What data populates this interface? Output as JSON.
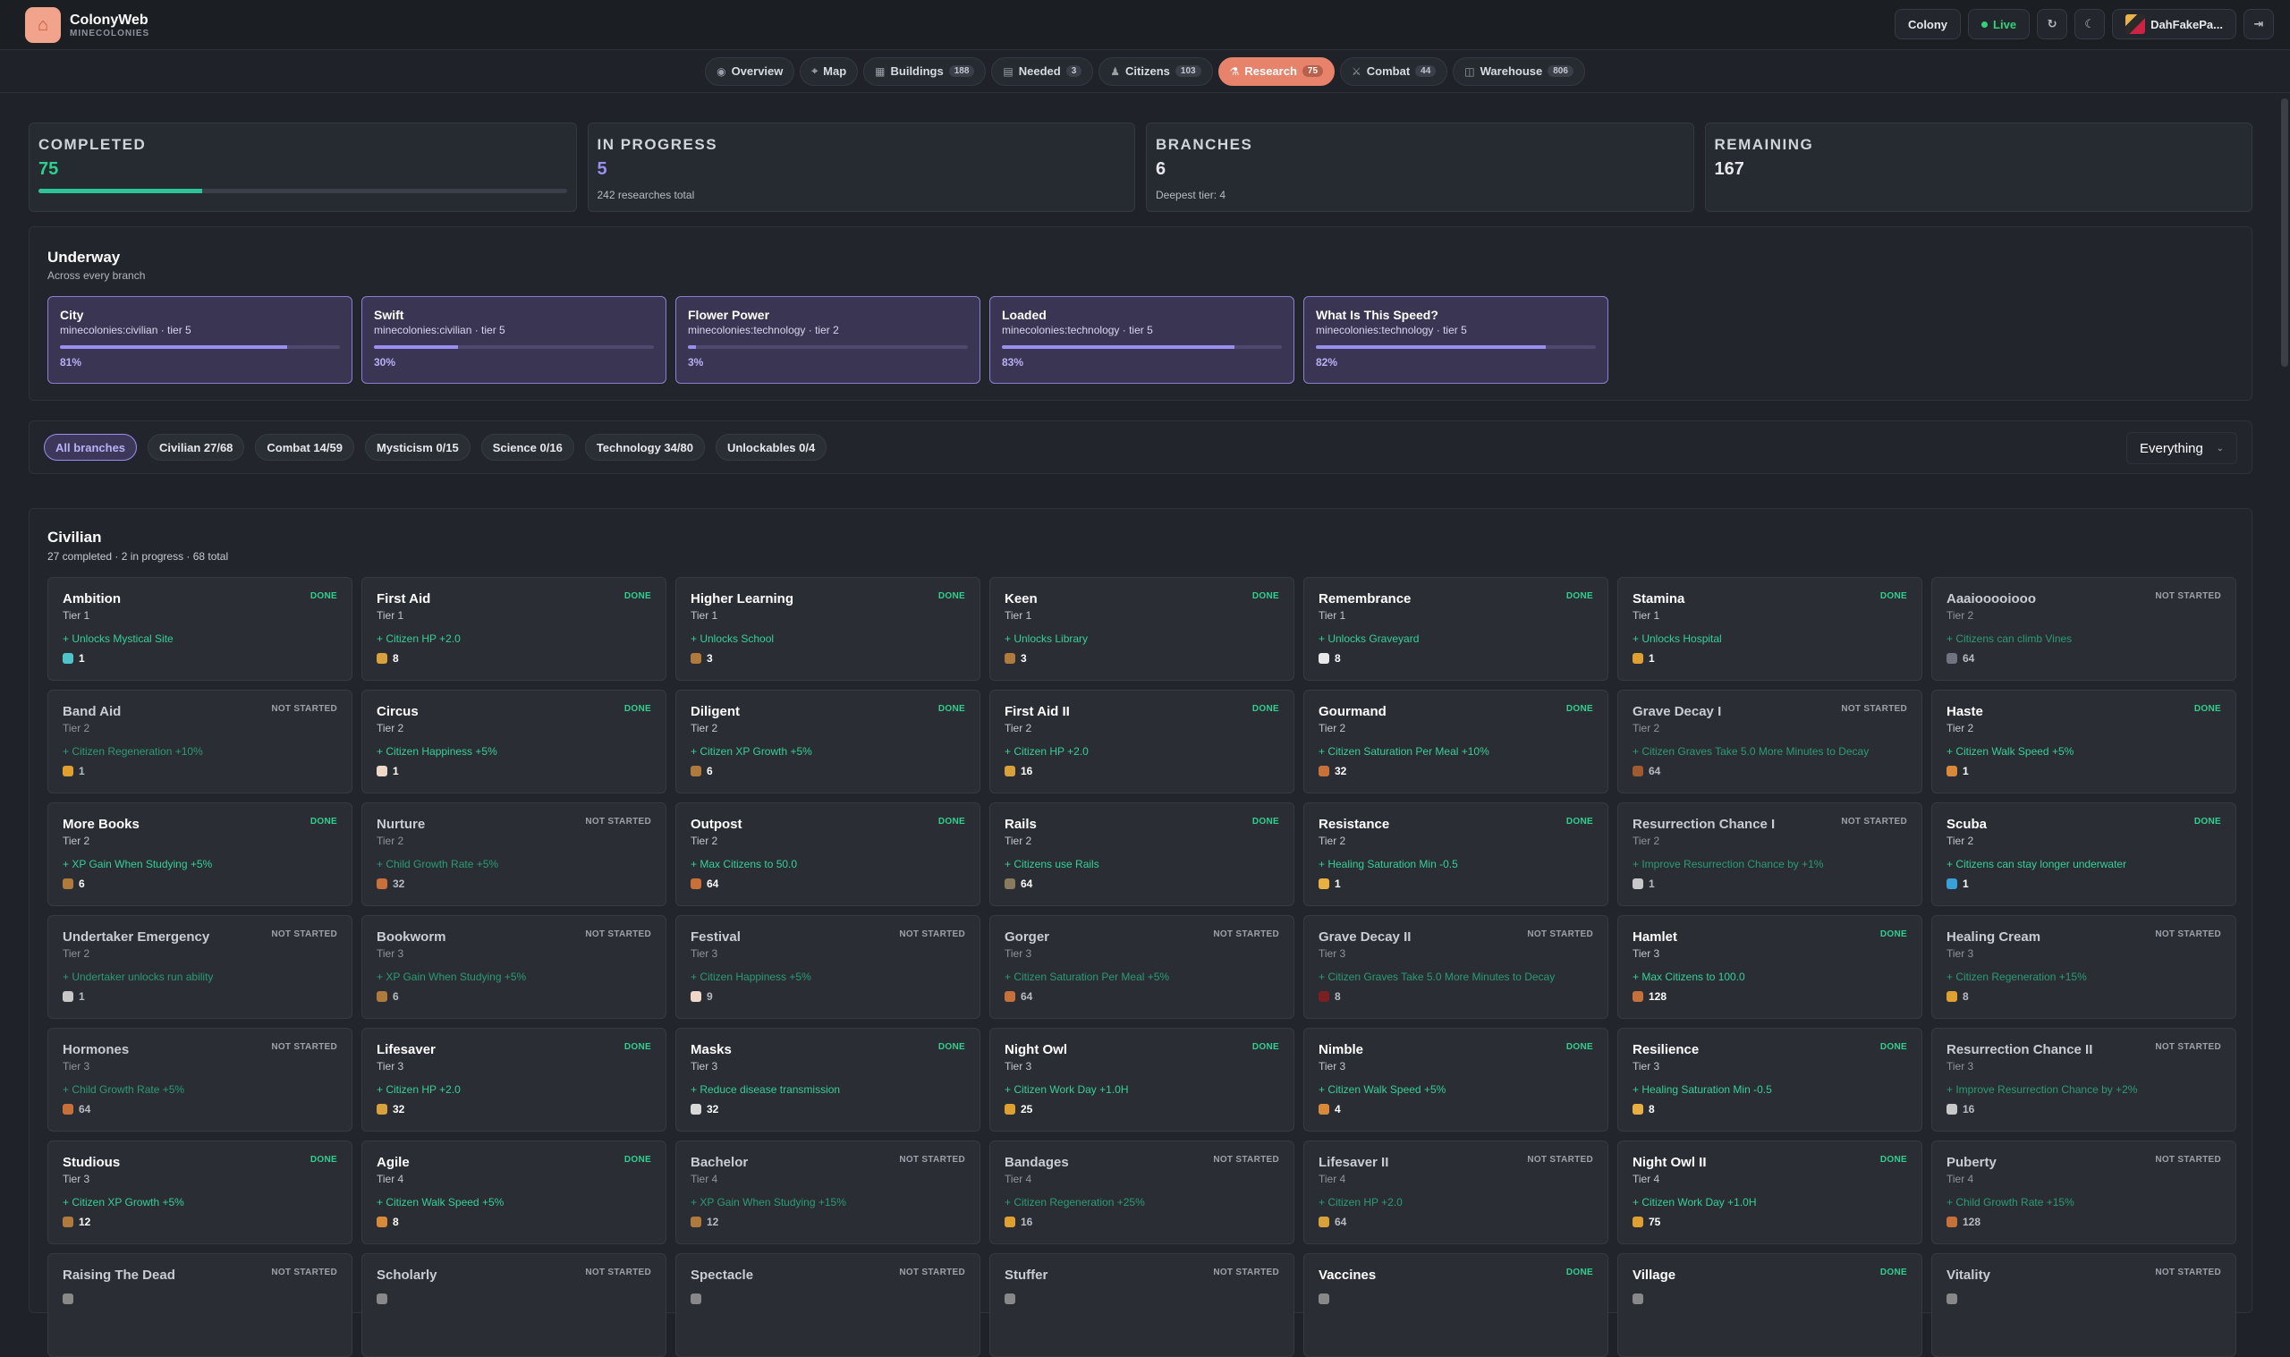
{
  "brand": {
    "name": "ColonyWeb",
    "sub": "MINECOLONIES"
  },
  "topright": {
    "colony": "Colony",
    "live": "Live",
    "user": "DahFakePa..."
  },
  "tabs": [
    {
      "label": "Overview",
      "count": "",
      "icon": "overview-icon"
    },
    {
      "label": "Map",
      "count": "",
      "icon": "map-icon"
    },
    {
      "label": "Buildings",
      "count": "188",
      "icon": "buildings-icon"
    },
    {
      "label": "Needed",
      "count": "3",
      "icon": "needed-icon"
    },
    {
      "label": "Citizens",
      "count": "103",
      "icon": "citizens-icon"
    },
    {
      "label": "Research",
      "count": "75",
      "icon": "research-icon",
      "active": true
    },
    {
      "label": "Combat",
      "count": "44",
      "icon": "combat-icon"
    },
    {
      "label": "Warehouse",
      "count": "806",
      "icon": "warehouse-icon"
    }
  ],
  "stats": {
    "completed": {
      "label": "COMPLETED",
      "value": "75",
      "progress": 0.31
    },
    "inprogress": {
      "label": "IN PROGRESS",
      "value": "5",
      "sub": "242 researches total"
    },
    "branches": {
      "label": "BRANCHES",
      "value": "6",
      "sub": "Deepest tier: 4"
    },
    "remaining": {
      "label": "REMAINING",
      "value": "167"
    }
  },
  "underway": {
    "title": "Underway",
    "sub": "Across every branch",
    "items": [
      {
        "name": "City",
        "meta": "minecolonies:civilian · tier 5",
        "pct": "81%",
        "p": 0.81
      },
      {
        "name": "Swift",
        "meta": "minecolonies:civilian · tier 5",
        "pct": "30%",
        "p": 0.3
      },
      {
        "name": "Flower Power",
        "meta": "minecolonies:technology · tier 2",
        "pct": "3%",
        "p": 0.03
      },
      {
        "name": "Loaded",
        "meta": "minecolonies:technology · tier 5",
        "pct": "83%",
        "p": 0.83
      },
      {
        "name": "What Is This Speed?",
        "meta": "minecolonies:technology · tier 5",
        "pct": "82%",
        "p": 0.82
      }
    ]
  },
  "filters": {
    "chips": [
      "All branches",
      "Civilian  27/68",
      "Combat  14/59",
      "Mysticism  0/15",
      "Science  0/16",
      "Technology  34/80",
      "Unlockables  0/4"
    ],
    "select": "Everything"
  },
  "section": {
    "title": "Civilian",
    "sub": "27 completed · 2 in progress · 68 total",
    "cards": [
      {
        "name": "Ambition",
        "tier": "Tier 1",
        "eff": "+ Unlocks Mystical Site",
        "cost": "1",
        "status": "DONE",
        "icolor": "#4fc3c7"
      },
      {
        "name": "First Aid",
        "tier": "Tier 1",
        "eff": "+ Citizen HP +2.0",
        "cost": "8",
        "status": "DONE",
        "icolor": "#d9a13a"
      },
      {
        "name": "Higher Learning",
        "tier": "Tier 1",
        "eff": "+ Unlocks School",
        "cost": "3",
        "status": "DONE",
        "icolor": "#b07a3c"
      },
      {
        "name": "Keen",
        "tier": "Tier 1",
        "eff": "+ Unlocks Library",
        "cost": "3",
        "status": "DONE",
        "icolor": "#b07a3c"
      },
      {
        "name": "Remembrance",
        "tier": "Tier 1",
        "eff": "+ Unlocks Graveyard",
        "cost": "8",
        "status": "DONE",
        "icolor": "#e8e8e8"
      },
      {
        "name": "Stamina",
        "tier": "Tier 1",
        "eff": "+ Unlocks Hospital",
        "cost": "1",
        "status": "DONE",
        "icolor": "#e0a030"
      },
      {
        "name": "Aaaiooooiooo",
        "tier": "Tier 2",
        "eff": "+ Citizens can climb Vines",
        "cost": "64",
        "status": "NOT STARTED",
        "icolor": "#707480"
      },
      {
        "name": "Band Aid",
        "tier": "Tier 2",
        "eff": "+ Citizen Regeneration +10%",
        "cost": "1",
        "status": "NOT STARTED",
        "icolor": "#e0a030"
      },
      {
        "name": "Circus",
        "tier": "Tier 2",
        "eff": "+ Citizen Happiness +5%",
        "cost": "1",
        "status": "DONE",
        "icolor": "#f0d8c8"
      },
      {
        "name": "Diligent",
        "tier": "Tier 2",
        "eff": "+ Citizen XP Growth +5%",
        "cost": "6",
        "status": "DONE",
        "icolor": "#b07a3c"
      },
      {
        "name": "First Aid II",
        "tier": "Tier 2",
        "eff": "+ Citizen HP +2.0",
        "cost": "16",
        "status": "DONE",
        "icolor": "#d9a13a"
      },
      {
        "name": "Gourmand",
        "tier": "Tier 2",
        "eff": "+ Citizen Saturation Per Meal +10%",
        "cost": "32",
        "status": "DONE",
        "icolor": "#c8703a"
      },
      {
        "name": "Grave Decay I",
        "tier": "Tier 2",
        "eff": "+ Citizen Graves Take 5.0 More Minutes to Decay",
        "cost": "64",
        "status": "NOT STARTED",
        "icolor": "#a05a30"
      },
      {
        "name": "Haste",
        "tier": "Tier 2",
        "eff": "+ Citizen Walk Speed +5%",
        "cost": "1",
        "status": "DONE",
        "icolor": "#d88a3a"
      },
      {
        "name": "More Books",
        "tier": "Tier 2",
        "eff": "+ XP Gain When Studying +5%",
        "cost": "6",
        "status": "DONE",
        "icolor": "#b07a3c"
      },
      {
        "name": "Nurture",
        "tier": "Tier 2",
        "eff": "+ Child Growth Rate +5%",
        "cost": "32",
        "status": "NOT STARTED",
        "icolor": "#c8703a"
      },
      {
        "name": "Outpost",
        "tier": "Tier 2",
        "eff": "+ Max Citizens to 50.0",
        "cost": "64",
        "status": "DONE",
        "icolor": "#c8703a"
      },
      {
        "name": "Rails",
        "tier": "Tier 2",
        "eff": "+ Citizens use Rails",
        "cost": "64",
        "status": "DONE",
        "icolor": "#8a7a60"
      },
      {
        "name": "Resistance",
        "tier": "Tier 2",
        "eff": "+ Healing Saturation Min -0.5",
        "cost": "1",
        "status": "DONE",
        "icolor": "#e8b040"
      },
      {
        "name": "Resurrection Chance I",
        "tier": "Tier 2",
        "eff": "+ Improve Resurrection Chance by +1%",
        "cost": "1",
        "status": "NOT STARTED",
        "icolor": "#c8c8c8"
      },
      {
        "name": "Scuba",
        "tier": "Tier 2",
        "eff": "+ Citizens can stay longer underwater",
        "cost": "1",
        "status": "DONE",
        "icolor": "#3aa0d8"
      },
      {
        "name": "Undertaker Emergency",
        "tier": "Tier 2",
        "eff": "+ Undertaker unlocks run ability",
        "cost": "1",
        "status": "NOT STARTED",
        "icolor": "#c8c8c8"
      },
      {
        "name": "Bookworm",
        "tier": "Tier 3",
        "eff": "+ XP Gain When Studying +5%",
        "cost": "6",
        "status": "NOT STARTED",
        "icolor": "#b07a3c"
      },
      {
        "name": "Festival",
        "tier": "Tier 3",
        "eff": "+ Citizen Happiness +5%",
        "cost": "9",
        "status": "NOT STARTED",
        "icolor": "#f0d8c8"
      },
      {
        "name": "Gorger",
        "tier": "Tier 3",
        "eff": "+ Citizen Saturation Per Meal +5%",
        "cost": "64",
        "status": "NOT STARTED",
        "icolor": "#c8703a"
      },
      {
        "name": "Grave Decay II",
        "tier": "Tier 3",
        "eff": "+ Citizen Graves Take 5.0 More Minutes to Decay",
        "cost": "8",
        "status": "NOT STARTED",
        "icolor": "#7a2020"
      },
      {
        "name": "Hamlet",
        "tier": "Tier 3",
        "eff": "+ Max Citizens to 100.0",
        "cost": "128",
        "status": "DONE",
        "icolor": "#c8703a"
      },
      {
        "name": "Healing Cream",
        "tier": "Tier 3",
        "eff": "+ Citizen Regeneration +15%",
        "cost": "8",
        "status": "NOT STARTED",
        "icolor": "#e0a030"
      },
      {
        "name": "Hormones",
        "tier": "Tier 3",
        "eff": "+ Child Growth Rate +5%",
        "cost": "64",
        "status": "NOT STARTED",
        "icolor": "#c8703a"
      },
      {
        "name": "Lifesaver",
        "tier": "Tier 3",
        "eff": "+ Citizen HP +2.0",
        "cost": "32",
        "status": "DONE",
        "icolor": "#d9a13a"
      },
      {
        "name": "Masks",
        "tier": "Tier 3",
        "eff": "+ Reduce disease transmission",
        "cost": "32",
        "status": "DONE",
        "icolor": "#d8d8d8"
      },
      {
        "name": "Night Owl",
        "tier": "Tier 3",
        "eff": "+ Citizen Work Day +1.0H",
        "cost": "25",
        "status": "DONE",
        "icolor": "#e0a030"
      },
      {
        "name": "Nimble",
        "tier": "Tier 3",
        "eff": "+ Citizen Walk Speed +5%",
        "cost": "4",
        "status": "DONE",
        "icolor": "#d88a3a"
      },
      {
        "name": "Resilience",
        "tier": "Tier 3",
        "eff": "+ Healing Saturation Min -0.5",
        "cost": "8",
        "status": "DONE",
        "icolor": "#e8b040"
      },
      {
        "name": "Resurrection Chance II",
        "tier": "Tier 3",
        "eff": "+ Improve Resurrection Chance by +2%",
        "cost": "16",
        "status": "NOT STARTED",
        "icolor": "#c8c8c8"
      },
      {
        "name": "Studious",
        "tier": "Tier 3",
        "eff": "+ Citizen XP Growth +5%",
        "cost": "12",
        "status": "DONE",
        "icolor": "#b07a3c"
      },
      {
        "name": "Agile",
        "tier": "Tier 4",
        "eff": "+ Citizen Walk Speed +5%",
        "cost": "8",
        "status": "DONE",
        "icolor": "#d88a3a"
      },
      {
        "name": "Bachelor",
        "tier": "Tier 4",
        "eff": "+ XP Gain When Studying +15%",
        "cost": "12",
        "status": "NOT STARTED",
        "icolor": "#b07a3c"
      },
      {
        "name": "Bandages",
        "tier": "Tier 4",
        "eff": "+ Citizen Regeneration +25%",
        "cost": "16",
        "status": "NOT STARTED",
        "icolor": "#e0a030"
      },
      {
        "name": "Lifesaver II",
        "tier": "Tier 4",
        "eff": "+ Citizen HP +2.0",
        "cost": "64",
        "status": "NOT STARTED",
        "icolor": "#d9a13a"
      },
      {
        "name": "Night Owl II",
        "tier": "Tier 4",
        "eff": "+ Citizen Work Day +1.0H",
        "cost": "75",
        "status": "DONE",
        "icolor": "#e0a030"
      },
      {
        "name": "Puberty",
        "tier": "Tier 4",
        "eff": "+ Child Growth Rate +15%",
        "cost": "128",
        "status": "NOT STARTED",
        "icolor": "#c8703a"
      },
      {
        "name": "Raising The Dead",
        "tier": "",
        "eff": "",
        "cost": "",
        "status": "NOT STARTED",
        "icolor": "#888"
      },
      {
        "name": "Scholarly",
        "tier": "",
        "eff": "",
        "cost": "",
        "status": "NOT STARTED",
        "icolor": "#888"
      },
      {
        "name": "Spectacle",
        "tier": "",
        "eff": "",
        "cost": "",
        "status": "NOT STARTED",
        "icolor": "#888"
      },
      {
        "name": "Stuffer",
        "tier": "",
        "eff": "",
        "cost": "",
        "status": "NOT STARTED",
        "icolor": "#888"
      },
      {
        "name": "Vaccines",
        "tier": "",
        "eff": "",
        "cost": "",
        "status": "DONE",
        "icolor": "#888"
      },
      {
        "name": "Village",
        "tier": "",
        "eff": "",
        "cost": "",
        "status": "DONE",
        "icolor": "#888"
      },
      {
        "name": "Vitality",
        "tier": "",
        "eff": "",
        "cost": "",
        "status": "NOT STARTED",
        "icolor": "#888"
      }
    ]
  }
}
